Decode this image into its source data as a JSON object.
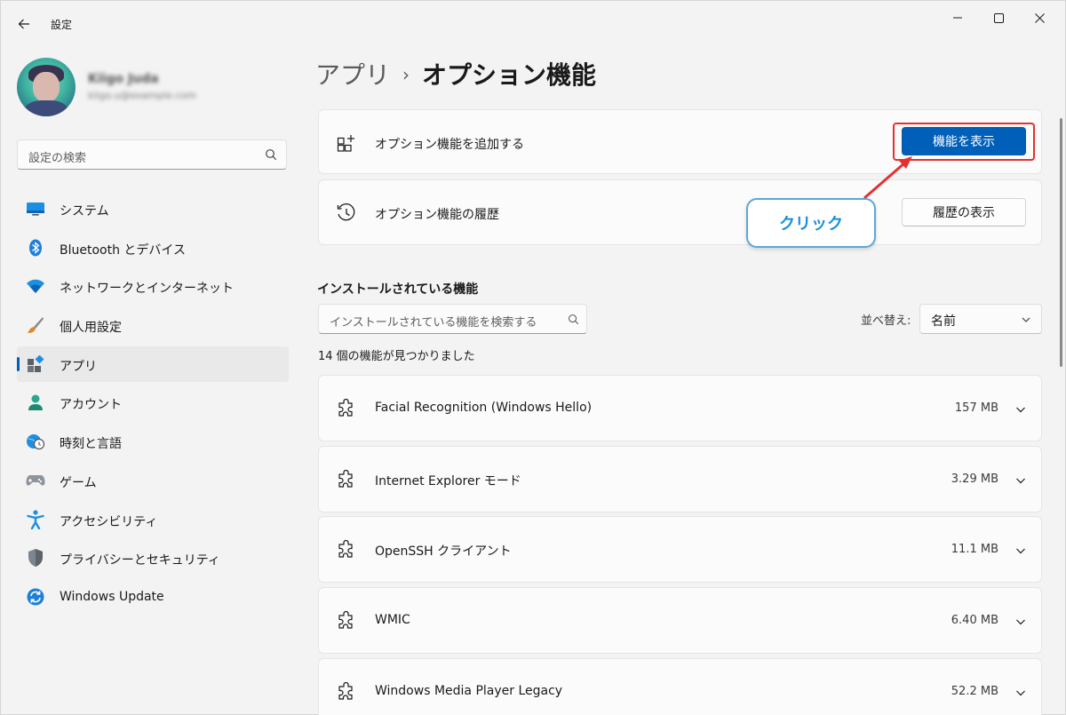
{
  "window": {
    "title": "設定"
  },
  "profile": {
    "name": "Kiigo Juda",
    "email": "kiigo.u@example.com"
  },
  "sidebar": {
    "search_placeholder": "設定の検索",
    "items": [
      {
        "label": "システム",
        "icon": "monitor-icon"
      },
      {
        "label": "Bluetooth とデバイス",
        "icon": "bluetooth-icon"
      },
      {
        "label": "ネットワークとインターネット",
        "icon": "wifi-icon"
      },
      {
        "label": "個人用設定",
        "icon": "brush-icon"
      },
      {
        "label": "アプリ",
        "icon": "apps-icon",
        "active": true
      },
      {
        "label": "アカウント",
        "icon": "account-icon"
      },
      {
        "label": "時刻と言語",
        "icon": "globe-clock-icon"
      },
      {
        "label": "ゲーム",
        "icon": "gamepad-icon"
      },
      {
        "label": "アクセシビリティ",
        "icon": "accessibility-icon"
      },
      {
        "label": "プライバシーとセキュリティ",
        "icon": "shield-icon"
      },
      {
        "label": "Windows Update",
        "icon": "update-icon"
      }
    ]
  },
  "breadcrumb": {
    "parent": "アプリ",
    "separator": "›",
    "current": "オプション機能"
  },
  "add_card": {
    "label": "オプション機能を追加する",
    "button": "機能を表示"
  },
  "history_card": {
    "label": "オプション機能の履歴",
    "button": "履歴の表示"
  },
  "annotation": {
    "text": "クリック",
    "color": "#e53030"
  },
  "installed": {
    "heading": "インストールされている機能",
    "search_placeholder": "インストールされている機能を検索する",
    "sort_label": "並べ替え:",
    "sort_value": "名前",
    "count_text": "14 個の機能が見つかりました",
    "features": [
      {
        "name": "Facial Recognition (Windows Hello)",
        "size": "157 MB"
      },
      {
        "name": "Internet Explorer モード",
        "size": "3.29 MB"
      },
      {
        "name": "OpenSSH クライアント",
        "size": "11.1 MB"
      },
      {
        "name": "WMIC",
        "size": "6.40 MB"
      },
      {
        "name": "Windows Media Player Legacy",
        "size": "52.2 MB"
      }
    ]
  },
  "colors": {
    "accent": "#005fb8",
    "callout_border": "#5aa8d8",
    "callout_text": "#1a90d8"
  }
}
